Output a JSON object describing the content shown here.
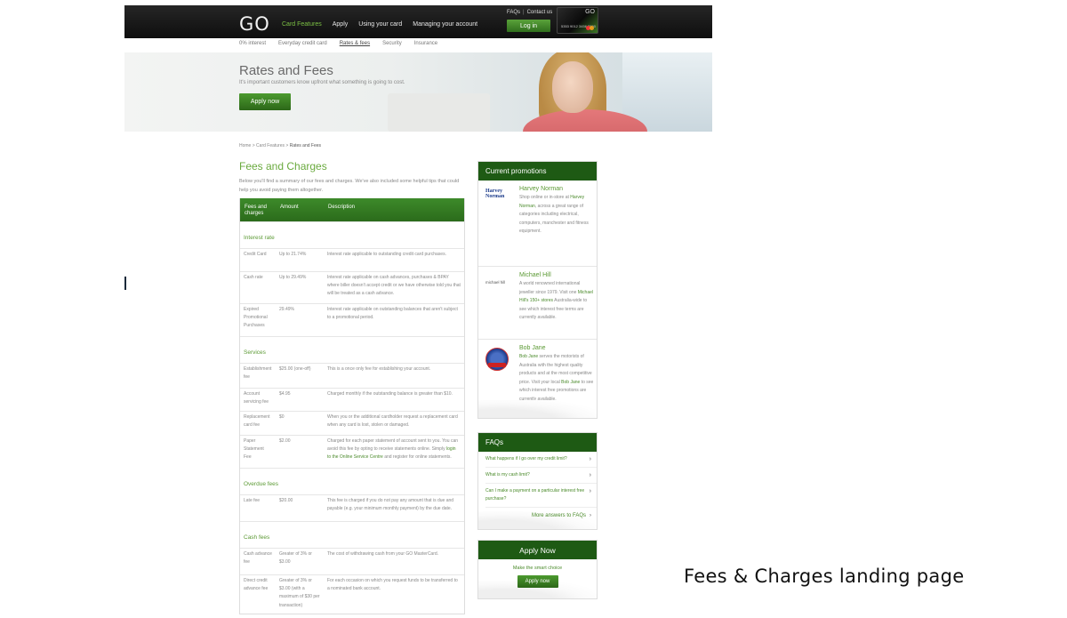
{
  "header": {
    "logo": "GO",
    "nav": [
      "Card Features",
      "Apply",
      "Using your card",
      "Managing your account"
    ],
    "active_nav": "Card Features",
    "utility_faqs": "FAQs",
    "utility_contact": "Contact us",
    "login_label": "Log in",
    "card": {
      "brand": "GO",
      "number": "5353 9012 3456 7890"
    }
  },
  "subnav": [
    "0% interest",
    "Everyday credit card",
    "Rates & fees",
    "Security",
    "Insurance"
  ],
  "active_subnav": "Rates & fees",
  "hero": {
    "title": "Rates and Fees",
    "subtitle": "It's important customers know upfront what something is going to cost.",
    "apply_label": "Apply now"
  },
  "breadcrumb": {
    "home": "Home",
    "sep": ">",
    "parent": "Card Features",
    "current": "Rates and Fees"
  },
  "main": {
    "title": "Fees and Charges",
    "intro": "Below you'll find a summary of our fees and charges. We've also included some helpful tips that could help you avoid paying them altogether.",
    "table_headers": [
      "Fees and charges",
      "Amount",
      "Description"
    ],
    "sections": [
      {
        "title": "Interest rate",
        "rows": [
          {
            "fee": "Credit Card",
            "amount": "Up to 21.74%",
            "desc": "Interest rate applicable to outstanding credit card purchases."
          },
          {
            "fee": "Cash rate",
            "amount": "Up to 29.49%",
            "desc": "Interest rate applicable on cash advances, purchases & BPAY where biller doesn't accept credit or we have otherwise told you that will be treated as a cash advance."
          },
          {
            "fee": "Expired Promotional Purchases",
            "amount": "29.49%",
            "desc": "Interest rate applicable on outstanding balances that aren't subject to a promotional period."
          }
        ]
      },
      {
        "title": "Services",
        "rows": [
          {
            "fee": "Establishment fee",
            "amount": "$25.00 (one-off)",
            "desc": "This is a once only fee for establishing your account."
          },
          {
            "fee": "Account servicing fee",
            "amount": "$4.95",
            "desc": "Charged monthly if the outstanding balance is greater than $10."
          },
          {
            "fee": "Replacement card fee",
            "amount": "$0",
            "desc": "When you or the additional cardholder request a replacement card when any card is lost, stolen or damaged."
          },
          {
            "fee": "Paper Statement Fee",
            "amount": "$2.00",
            "desc": "Charged for each paper statement of account sent to you. You can avoid this fee by opting to receive statements online. Simply ",
            "link": "login to the Online Service Centre",
            "desc_after": " and register for online statements."
          }
        ]
      },
      {
        "title": "Overdue fees",
        "rows": [
          {
            "fee": "Late fee",
            "amount": "$20.00",
            "desc": "This fee is charged if you do not pay any amount that is due and payable (e.g. your minimum monthly payment) by the due date."
          }
        ]
      },
      {
        "title": "Cash fees",
        "rows": [
          {
            "fee": "Cash advance fee",
            "amount": "Greater of 3% or $3.00",
            "desc": "The cost of withdrawing cash from your GO MasterCard."
          },
          {
            "fee": "Direct credit advance fee",
            "amount": "Greater of 3% or $3.00 (with a maximum of $30 per transaction)",
            "desc": "For each occasion on which you request funds to be transferred to a nominated bank account."
          }
        ]
      }
    ]
  },
  "promotions": {
    "title": "Current promotions",
    "items": [
      {
        "name": "Harvey Norman",
        "logo_text": "Harvey Norman",
        "pre": "Shop online or in-store at ",
        "link": "Harvey Norman",
        "post": ", across a great range of categories including electrical, computers, manchester and fitness equipment."
      },
      {
        "name": "Michael Hill",
        "logo_text": "michael hill",
        "pre": "A world renowned international jeweller since 1979. Visit one ",
        "link": "Michael Hill's 150+ stores",
        "post": " Australia-wide to see which interest free terms are currently available."
      },
      {
        "name": "Bob Jane",
        "logo_text": "BOB JANE T-MARTS",
        "pre": "",
        "link": "Bob Jane",
        "post": " serves the motorists of Australia with the highest quality products and at the most competitive price. Visit your local ",
        "link2": "Bob Jane",
        "post2": " to see which interest free promotions are currently available."
      }
    ]
  },
  "faqs": {
    "title": "FAQs",
    "items": [
      "What happens if I go over my credit limit?",
      "What is my cash limit?",
      "Can I make a payment on a particular interest free purchase?"
    ],
    "more": "More answers to FAQs"
  },
  "apply_panel": {
    "title": "Apply Now",
    "tagline": "Make the smart choice",
    "button": "Apply now"
  },
  "caption": "Fees & Charges landing page",
  "colors": {
    "brand_green": "#3d8a2a",
    "dark_green": "#1e5a14",
    "link_green": "#5c9a35",
    "header_black": "#141414"
  }
}
